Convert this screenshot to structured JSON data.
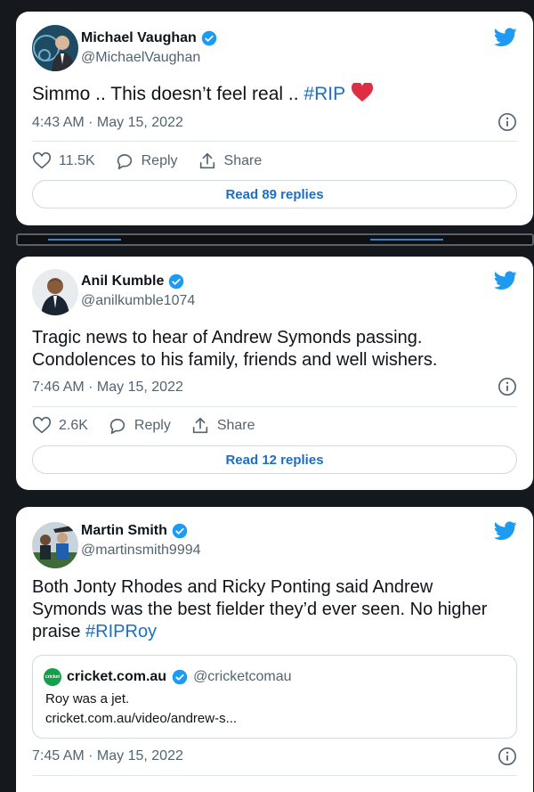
{
  "tweets": [
    {
      "name": "Michael Vaughan",
      "handle": "@MichaelVaughan",
      "text_main": "Simmo .. This doesn’t feel real .. ",
      "hashtag": "#RIP",
      "emoji": "❤️",
      "timestamp": "4:43 AM · May 15, 2022",
      "likes": "11.5K",
      "reply_label": "Reply",
      "share_label": "Share",
      "read_replies": "Read 89 replies"
    },
    {
      "name": "Anil Kumble",
      "handle": "@anilkumble1074",
      "text_line1": "Tragic news to hear of Andrew Symonds passing.",
      "text_line2": "Condolences to his family, friends and well wishers.",
      "timestamp": "7:46 AM · May 15, 2022",
      "likes": "2.6K",
      "reply_label": "Reply",
      "share_label": "Share",
      "read_replies": "Read 12 replies"
    },
    {
      "name": "Martin Smith",
      "handle": "@martinsmith9994",
      "text_line1": "Both Jonty Rhodes and Ricky Ponting said Andrew",
      "text_line2": "Symonds was the best fielder they’d ever seen. No higher",
      "text_line3_plain": "praise ",
      "hashtag": "#RIPRoy",
      "quote": {
        "logo_text": "cricket",
        "name": "cricket.com.au",
        "handle": "@cricketcomau",
        "line1": "Roy was a jet.",
        "line2": "cricket.com.au/video/andrew-s..."
      },
      "timestamp": "7:45 AM · May 15, 2022"
    }
  ],
  "colors": {
    "accent": "#1d6ec2",
    "twitter_blue": "#1d9bf0",
    "background": "#15181c",
    "heart": "#e0245e"
  }
}
